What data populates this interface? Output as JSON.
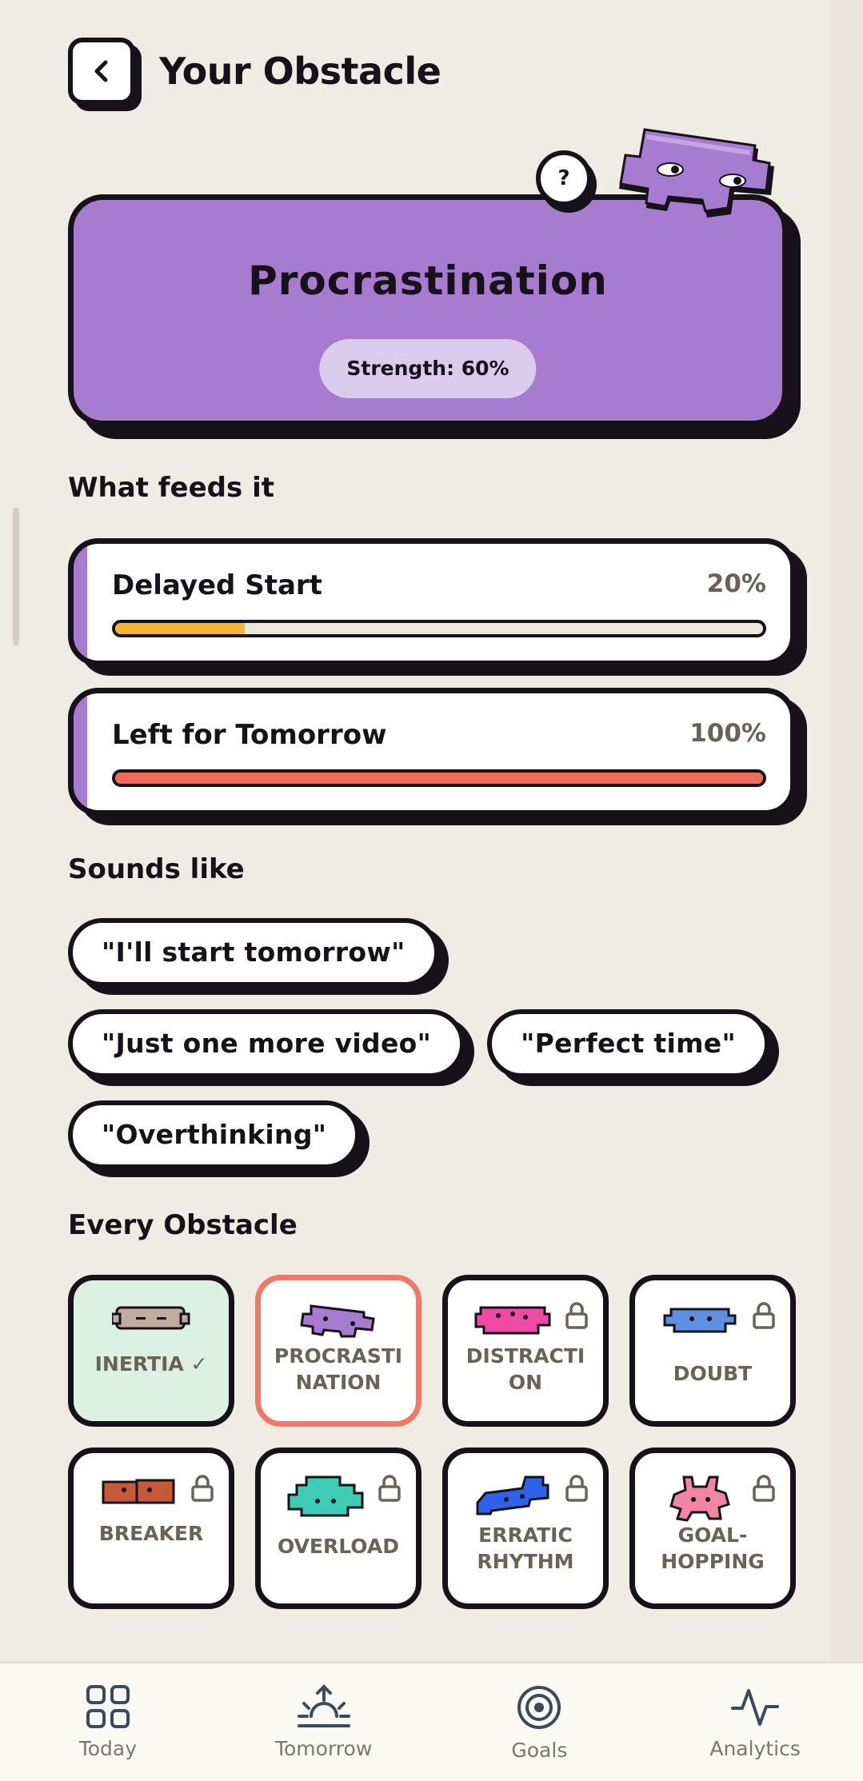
{
  "header": {
    "title": "Your Obstacle"
  },
  "hero": {
    "title": "Procrastination",
    "strength_label": "Strength: 60%",
    "strength": 0.6,
    "help_label": "?"
  },
  "feeds": {
    "title": "What feeds it",
    "items": [
      {
        "label": "Delayed Start",
        "pct_label": "20%",
        "value": 0.2,
        "color": "#f5b731"
      },
      {
        "label": "Left for Tomorrow",
        "pct_label": "100%",
        "value": 1.0,
        "color": "#ef6b57"
      }
    ]
  },
  "sounds": {
    "title": "Sounds like",
    "quotes": [
      "\"I'll start tomorrow\"",
      "\"Just one more video\"",
      "\"Perfect time\"",
      "\"Overthinking\""
    ]
  },
  "obstacles": {
    "title": "Every Obstacle",
    "check_mark": "✓",
    "items": [
      {
        "line1": "INERTIA",
        "line2": "",
        "status": "completed",
        "color": "#c1ada0"
      },
      {
        "line1": "PROCRASTI",
        "line2": "NATION",
        "status": "selected",
        "color": "#a77bcf"
      },
      {
        "line1": "DISTRACTI",
        "line2": "ON",
        "status": "locked",
        "color": "#ef49a6"
      },
      {
        "line1": "DOUBT",
        "line2": "",
        "status": "locked",
        "color": "#5f8fe0"
      },
      {
        "line1": "BREAKER",
        "line2": "",
        "status": "locked",
        "color": "#c65a37"
      },
      {
        "line1": "OVERLOAD",
        "line2": "",
        "status": "locked",
        "color": "#3ccdb4"
      },
      {
        "line1": "ERRATIC",
        "line2": "RHYTHM",
        "status": "locked",
        "color": "#2f62e8"
      },
      {
        "line1": "GOAL-",
        "line2": "HOPPING",
        "status": "locked",
        "color": "#f186a4"
      }
    ]
  },
  "nav": {
    "items": [
      {
        "label": "Today",
        "icon": "grid-icon"
      },
      {
        "label": "Tomorrow",
        "icon": "sunrise-icon"
      },
      {
        "label": "Goals",
        "icon": "target-icon"
      },
      {
        "label": "Analytics",
        "icon": "activity-icon"
      }
    ]
  },
  "colors": {
    "background": "#efece3",
    "accent_purple": "#a77bcf",
    "ink": "#17121a",
    "progress_yellow": "#f5b731",
    "progress_red": "#ef6b57",
    "selected_border": "#f07868",
    "completed_tile": "#ddf0e4"
  }
}
